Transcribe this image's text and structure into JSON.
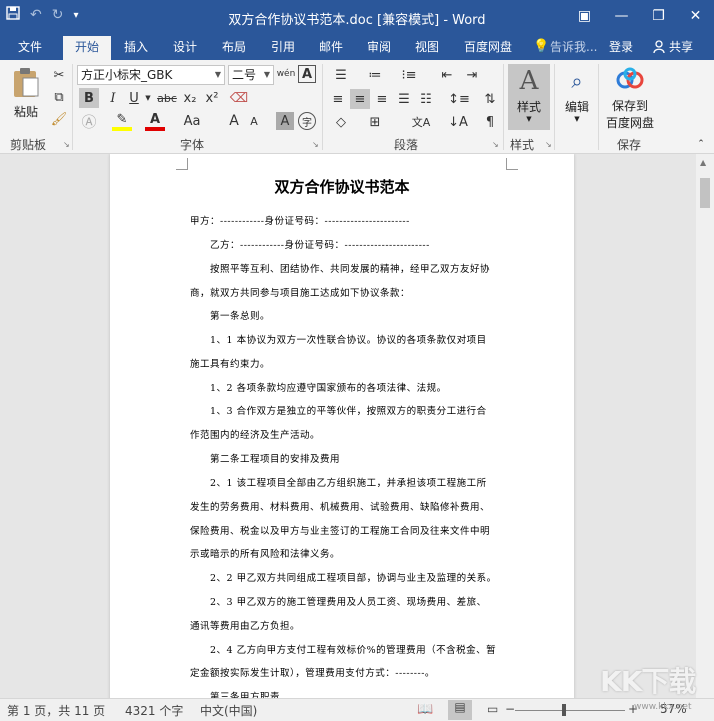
{
  "window": {
    "title": "双方合作协议书范本.doc [兼容模式] - Word",
    "qat": {
      "save_icon": "save-icon",
      "undo_icon": "undo-icon",
      "redo_icon": "redo-icon",
      "customize_icon": "customize-qat-icon"
    },
    "controls": {
      "ribbon_display": "▣",
      "minimize": "—",
      "restore": "❐",
      "close": "✕"
    }
  },
  "tabs": {
    "items": [
      {
        "label": "文件",
        "active": false
      },
      {
        "label": "开始",
        "active": true
      },
      {
        "label": "插入",
        "active": false
      },
      {
        "label": "设计",
        "active": false
      },
      {
        "label": "布局",
        "active": false
      },
      {
        "label": "引用",
        "active": false
      },
      {
        "label": "邮件",
        "active": false
      },
      {
        "label": "审阅",
        "active": false
      },
      {
        "label": "视图",
        "active": false
      },
      {
        "label": "百度网盘",
        "active": false
      }
    ],
    "tell_me": "告诉我...",
    "login": "登录",
    "share": "共享"
  },
  "ribbon": {
    "clipboard": {
      "label": "剪贴板",
      "paste": "粘贴"
    },
    "font": {
      "label": "字体",
      "font_name": "方正小标宋_GBK",
      "font_size": "二号",
      "bold": "B",
      "italic": "I",
      "underline": "U",
      "strike": "abc",
      "subscript": "x₂",
      "superscript": "x²",
      "font_color_letter": "A",
      "char_shading": "A",
      "grow": "A",
      "shrink": "A",
      "case": "Aa",
      "phonetic": "wén",
      "border_letter": "A",
      "enclose": "字"
    },
    "paragraph": {
      "label": "段落"
    },
    "styles": {
      "label": "样式",
      "button": "样式"
    },
    "editing": {
      "button": "编辑"
    },
    "save": {
      "label": "保存",
      "button_line1": "保存到",
      "button_line2": "百度网盘"
    }
  },
  "document": {
    "title": "双方合作协议书范本",
    "lines": [
      "甲方：------------身份证号码：-----------------------",
      "乙方：------------身份证号码：-----------------------",
      "按照平等互利、团结协作、共同发展的精神，经甲乙双方友好协",
      "商，就双方共同参与项目施工达成如下协议条款：",
      "第一条总则。",
      "1、1 本协议为双方一次性联合协议。协议的各项条款仅对项目",
      "施工具有约束力。",
      "1、2 各项条款均应遵守国家颁布的各项法律、法规。",
      "1、3 合作双方是独立的平等伙伴，按照双方的职责分工进行合",
      "作范围内的经济及生产活动。",
      "第二条工程项目的安排及费用",
      "2、1 该工程项目全部由乙方组织施工，并承担该项工程施工所",
      "发生的劳务费用、材料费用、机械费用、试验费用、缺陷修补费用、",
      "保险费用、税金以及甲方与业主签订的工程施工合同及往来文件中明",
      "示或暗示的所有风险和法律义务。",
      "2、2 甲乙双方共同组成工程项目部，协调与业主及监理的关系。",
      "2、3 甲乙双方的施工管理费用及人员工资、现场费用、差旅、",
      "通讯等费用由乙方负担。",
      "2、4 乙方向甲方支付工程有效标价%的管理费用（不含税金、暂",
      "定金额按实际发生计取），管理费用支付方式：--------。",
      "第三条甲方职责"
    ]
  },
  "status": {
    "page": "第 1 页，共 11 页",
    "words": "4321 个字",
    "language": "中文(中国)",
    "zoom_minus": "−",
    "zoom_plus": "+",
    "zoom": "57%"
  },
  "watermark": {
    "logo": "KK下载",
    "url": "www.kkx.net"
  }
}
